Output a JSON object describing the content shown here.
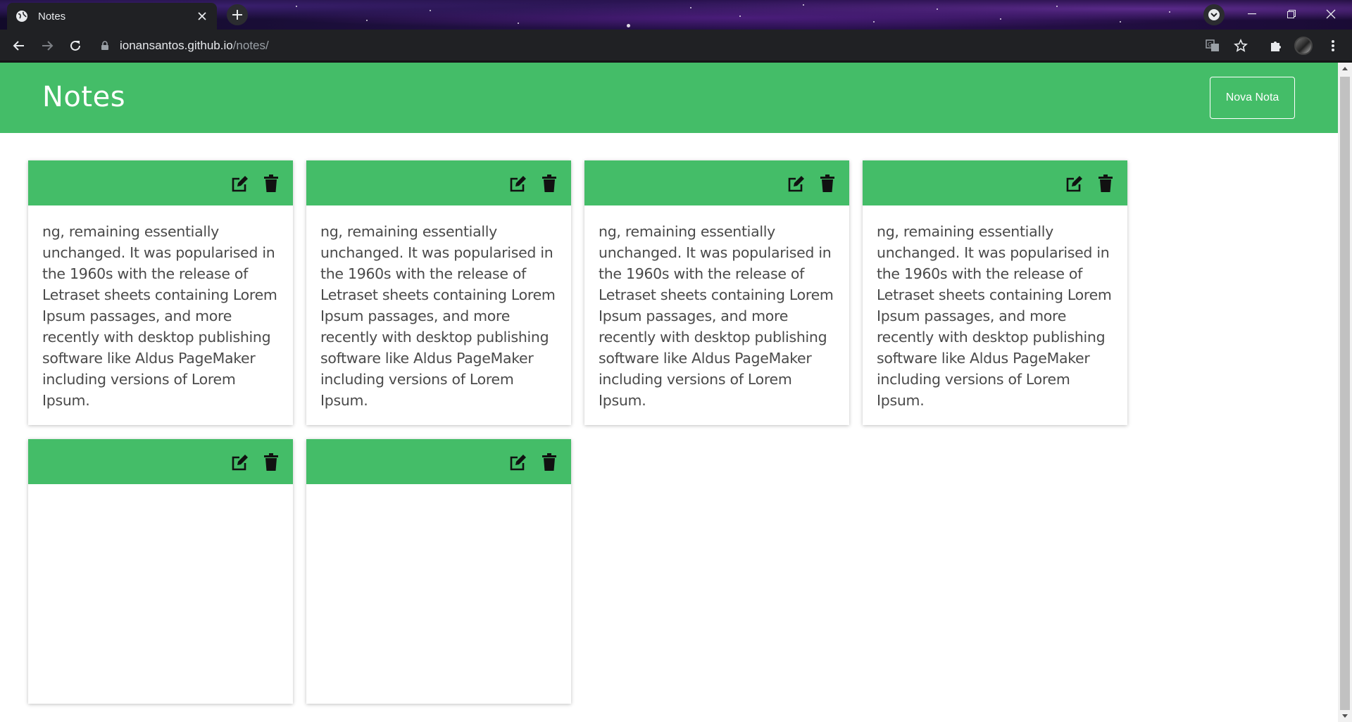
{
  "browser": {
    "tab_title": "Notes",
    "url_host": "ionansantos.github.io",
    "url_path": "/notes/"
  },
  "app": {
    "title": "Notes",
    "new_note_label": "Nova Nota",
    "accent_color": "#44bd68"
  },
  "notes": [
    {
      "text": "ng, remaining essentially unchanged. It was popularised in the 1960s with the release of Letraset sheets containing Lorem Ipsum passages, and more recently with desktop publishing software like Aldus PageMaker including versions of Lorem Ipsum."
    },
    {
      "text": "ng, remaining essentially unchanged. It was popularised in the 1960s with the release of Letraset sheets containing Lorem Ipsum passages, and more recently with desktop publishing software like Aldus PageMaker including versions of Lorem Ipsum."
    },
    {
      "text": "ng, remaining essentially unchanged. It was popularised in the 1960s with the release of Letraset sheets containing Lorem Ipsum passages, and more recently with desktop publishing software like Aldus PageMaker including versions of Lorem Ipsum."
    },
    {
      "text": "ng, remaining essentially unchanged. It was popularised in the 1960s with the release of Letraset sheets containing Lorem Ipsum passages, and more recently with desktop publishing software like Aldus PageMaker including versions of Lorem Ipsum."
    },
    {
      "text": ""
    },
    {
      "text": ""
    }
  ],
  "icons": {
    "edit": "edit-icon",
    "delete": "trash-icon"
  }
}
